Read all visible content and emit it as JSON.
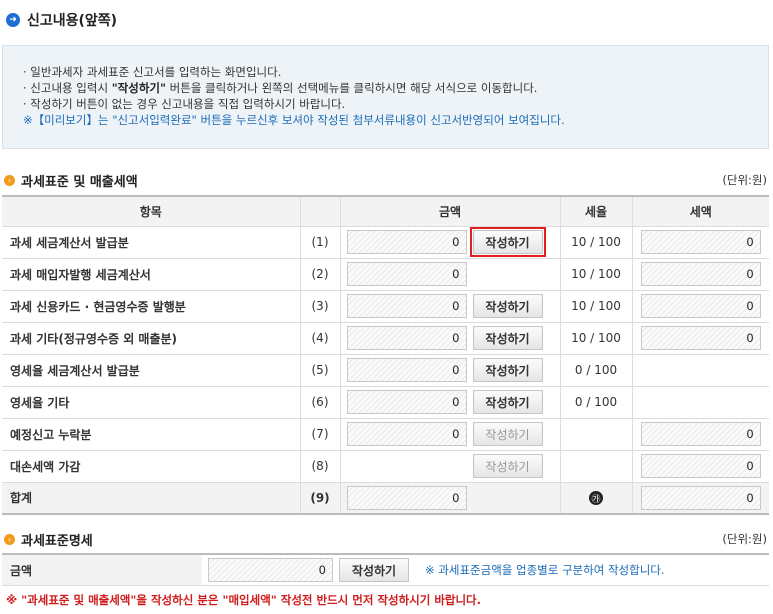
{
  "page": {
    "title": "신고내용(앞쪽)",
    "info_lines": [
      "· 일반과세자 과세표준 신고서를 입력하는 화면입니다.",
      "· 작성하기 버튼이 없는 경우 신고내용을 직접 입력하시기 바랍니다.",
      "※【미리보기】는 \"신고서입력완료\" 버튼을 누르신후 보셔야 작성된 첨부서류내용이 신고서반영되어 보여집니다."
    ],
    "info_line2_pre": "· 신고내용 입력시 ",
    "info_line2_bold": "\"작성하기\"",
    "info_line2_post": " 버튼을 클릭하거나 왼쪽의 선택메뉴를 클릭하시면 해당 서식으로 이동합니다."
  },
  "section1": {
    "title": "과세표준 및 매출세액",
    "unit": "(단위:원)",
    "headers": {
      "item": "항목",
      "amount": "금액",
      "rate": "세율",
      "tax": "세액"
    },
    "rows": [
      {
        "label": "과세 세금계산서 발급분",
        "num": "(1)",
        "amount": "0",
        "button": "작성하기",
        "rate": "10 / 100",
        "tax": "0"
      },
      {
        "label": "과세 매입자발행 세금계산서",
        "num": "(2)",
        "amount": "0",
        "rate": "10 / 100",
        "tax": "0"
      },
      {
        "label": "과세 신용카드 · 현금영수증 발행분",
        "num": "(3)",
        "amount": "0",
        "button": "작성하기",
        "rate": "10 / 100",
        "tax": "0"
      },
      {
        "label": "과세 기타(정규영수증 외 매출분)",
        "num": "(4)",
        "amount": "0",
        "button": "작성하기",
        "rate": "10 / 100",
        "tax": "0"
      },
      {
        "label": "영세율 세금계산서 발급분",
        "num": "(5)",
        "amount": "0",
        "button": "작성하기",
        "rate": "0 / 100"
      },
      {
        "label": "영세율 기타",
        "num": "(6)",
        "amount": "0",
        "button": "작성하기",
        "rate": "0 / 100"
      },
      {
        "label": "예정신고 누락분",
        "num": "(7)",
        "amount": "0",
        "button": "작성하기",
        "tax": "0"
      },
      {
        "label": "대손세액 가감",
        "num": "(8)",
        "button": "작성하기",
        "tax": "0"
      }
    ],
    "total": {
      "label": "합계",
      "num": "(9)",
      "amount": "0",
      "rate_mark": "㉮",
      "tax": "0"
    }
  },
  "section2": {
    "title": "과세표준명세",
    "unit": "(단위:원)",
    "label": "금액",
    "amount": "0",
    "button": "작성하기",
    "note": "※ 과세표준금액을 업종별로 구분하여 작성합니다."
  },
  "warning": "※ \"과세표준 및 매출세액\"을 작성하신 분은 \"매입세액\" 작성전 반드시 먼저 작성하시기 바랍니다."
}
